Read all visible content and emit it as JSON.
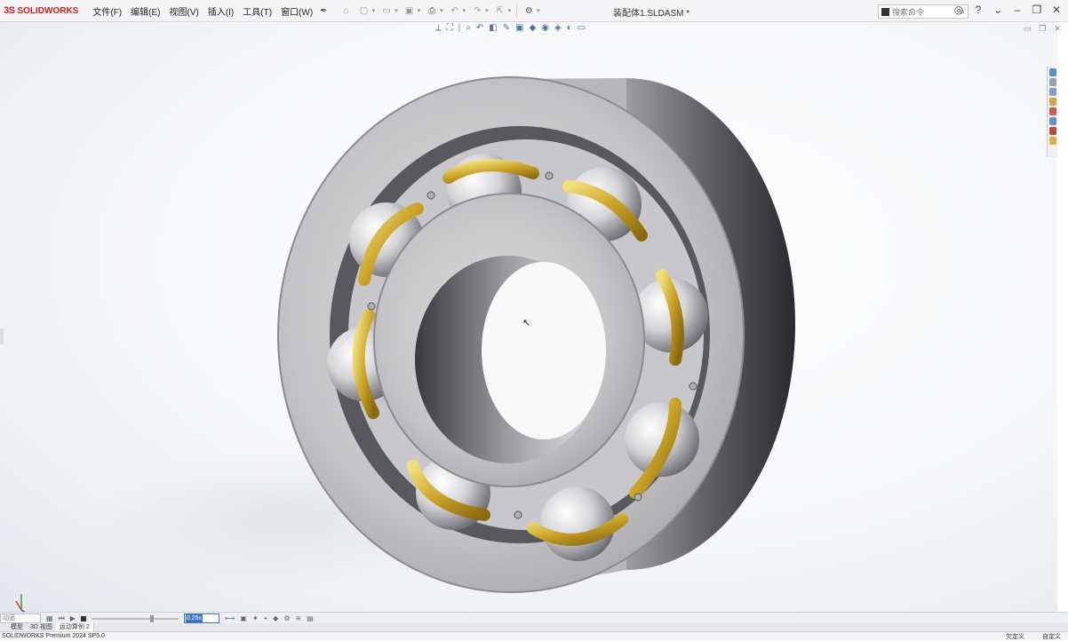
{
  "app": {
    "logo_ds": "3S",
    "logo_name": "SOLIDWORKS"
  },
  "menu": [
    "文件(F)",
    "编辑(E)",
    "视图(V)",
    "插入(I)",
    "工具(T)",
    "窗口(W)"
  ],
  "document": {
    "title": "装配体1.SLDASM *"
  },
  "search": {
    "placeholder": "搜索命令"
  },
  "motion": {
    "study_type": "动画",
    "playback_speed": "0.25x",
    "tabs": [
      "模型",
      "3D 视图",
      "运动算例 2"
    ],
    "active_tab": "运动算例 2"
  },
  "status": {
    "product": "SOLIDWORKS Premium 2024 SP5.0",
    "right_text": "欠定义",
    "right_text2": "自定义"
  },
  "colors": {
    "brand": "#d01d1d",
    "cage_gold": "#c9a227",
    "ring_steel": "#bfbfc1",
    "selection": "#3a74c9"
  }
}
